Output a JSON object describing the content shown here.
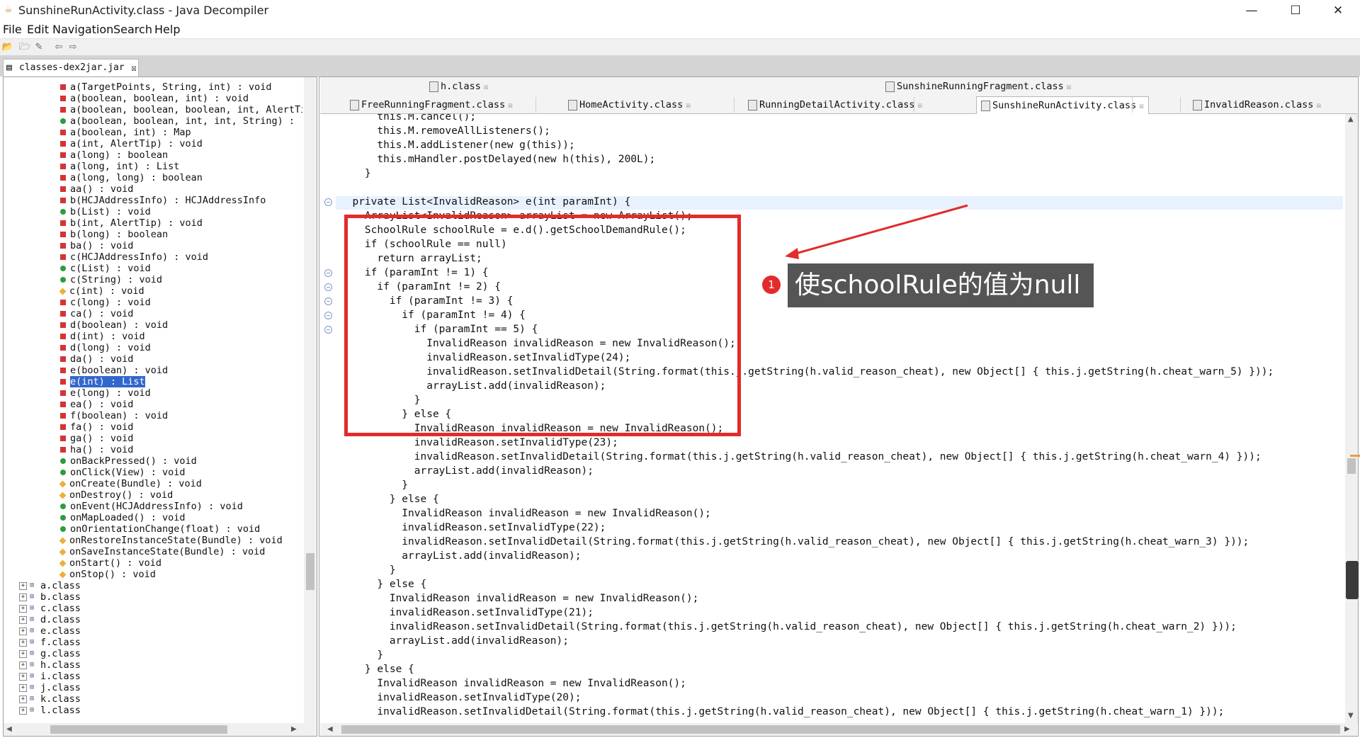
{
  "window": {
    "title": "SunshineRunActivity.class - Java Decompiler",
    "min_label": "—",
    "max_label": "☐",
    "close_label": "✕"
  },
  "menu": [
    "File",
    "Edit",
    "Navigation",
    "Search",
    "Help"
  ],
  "left_tab": {
    "label": "classes-dex2jar.jar"
  },
  "tree": {
    "members": [
      {
        "kind": "private",
        "label": "a(TargetPoints, String, int) : void"
      },
      {
        "kind": "private",
        "label": "a(boolean, boolean, int) : void"
      },
      {
        "kind": "private",
        "label": "a(boolean, boolean, boolean, int, AlertTip) : voi"
      },
      {
        "kind": "public",
        "label": "a(boolean, boolean, int, int, String) : '"
      },
      {
        "kind": "private",
        "label": "a(boolean, int) : Map"
      },
      {
        "kind": "private",
        "label": "a(int, AlertTip) : void"
      },
      {
        "kind": "private",
        "label": "a(long) : boolean"
      },
      {
        "kind": "private",
        "label": "a(long, int) : List"
      },
      {
        "kind": "private",
        "label": "a(long, long) : boolean"
      },
      {
        "kind": "private",
        "label": "aa() : void"
      },
      {
        "kind": "private",
        "label": "b(HCJAddressInfo) : HCJAddressInfo"
      },
      {
        "kind": "public",
        "label": "b(List) : void"
      },
      {
        "kind": "private",
        "label": "b(int, AlertTip) : void"
      },
      {
        "kind": "private",
        "label": "b(long) : boolean"
      },
      {
        "kind": "private",
        "label": "ba() : void"
      },
      {
        "kind": "private",
        "label": "c(HCJAddressInfo) : void"
      },
      {
        "kind": "public",
        "label": "c(List) : void"
      },
      {
        "kind": "public",
        "label": "c(String) : void"
      },
      {
        "kind": "protected",
        "label": "c(int) : void"
      },
      {
        "kind": "private",
        "label": "c(long) : void"
      },
      {
        "kind": "private",
        "label": "ca() : void"
      },
      {
        "kind": "private",
        "label": "d(boolean) : void"
      },
      {
        "kind": "private",
        "label": "d(int) : void"
      },
      {
        "kind": "private",
        "label": "d(long) : void"
      },
      {
        "kind": "private",
        "label": "da() : void"
      },
      {
        "kind": "private",
        "label": "e(boolean) : void"
      },
      {
        "kind": "private",
        "label": "e(int) : List",
        "selected": true
      },
      {
        "kind": "private",
        "label": "e(long) : void"
      },
      {
        "kind": "private",
        "label": "ea() : void"
      },
      {
        "kind": "private",
        "label": "f(boolean) : void"
      },
      {
        "kind": "private",
        "label": "fa() : void"
      },
      {
        "kind": "private",
        "label": "ga() : void"
      },
      {
        "kind": "private",
        "label": "ha() : void"
      },
      {
        "kind": "public",
        "label": "onBackPressed() : void"
      },
      {
        "kind": "public",
        "label": "onClick(View) : void"
      },
      {
        "kind": "protected",
        "label": "onCreate(Bundle) : void"
      },
      {
        "kind": "protected",
        "label": "onDestroy() : void"
      },
      {
        "kind": "public",
        "label": "onEvent(HCJAddressInfo) : void"
      },
      {
        "kind": "public",
        "label": "onMapLoaded() : void"
      },
      {
        "kind": "public",
        "label": "onOrientationChange(float) : void"
      },
      {
        "kind": "protected",
        "label": "onRestoreInstanceState(Bundle) : void"
      },
      {
        "kind": "protected",
        "label": "onSaveInstanceState(Bundle) : void"
      },
      {
        "kind": "protected",
        "label": "onStart() : void"
      },
      {
        "kind": "protected",
        "label": "onStop() : void"
      }
    ],
    "classes": [
      "a.class",
      "b.class",
      "c.class",
      "d.class",
      "e.class",
      "f.class",
      "g.class",
      "h.class",
      "i.class",
      "j.class",
      "k.class",
      "l.class"
    ]
  },
  "editor_tabs": {
    "row1": [
      "h.class",
      "SunshineRunningFragment.class"
    ],
    "row2": [
      "FreeRunningFragment.class",
      "HomeActivity.class",
      "RunningDetailActivity.class",
      "SunshineRunActivity.class",
      "InvalidReason.class"
    ],
    "active": "SunshineRunActivity.class"
  },
  "code_lines": [
    "      this.M.cancel();",
    "      this.M.removeAllListeners();",
    "      this.M.addListener(new g(this));",
    "      this.mHandler.postDelayed(new h(this), 200L);",
    "    }",
    "",
    "  private List<InvalidReason> e(int paramInt) {",
    "    ArrayList<InvalidReason> arrayList = new ArrayList();",
    "    SchoolRule schoolRule = e.d().getSchoolDemandRule();",
    "    if (schoolRule == null)",
    "      return arrayList;",
    "    if (paramInt != 1) {",
    "      if (paramInt != 2) {",
    "        if (paramInt != 3) {",
    "          if (paramInt != 4) {",
    "            if (paramInt == 5) {",
    "              InvalidReason invalidReason = new InvalidReason();",
    "              invalidReason.setInvalidType(24);",
    "              invalidReason.setInvalidDetail(String.format(this.j.getString(h.valid_reason_cheat), new Object[] { this.j.getString(h.cheat_warn_5) }));",
    "              arrayList.add(invalidReason);",
    "            }",
    "          } else {",
    "            InvalidReason invalidReason = new InvalidReason();",
    "            invalidReason.setInvalidType(23);",
    "            invalidReason.setInvalidDetail(String.format(this.j.getString(h.valid_reason_cheat), new Object[] { this.j.getString(h.cheat_warn_4) }));",
    "            arrayList.add(invalidReason);",
    "          }",
    "        } else {",
    "          InvalidReason invalidReason = new InvalidReason();",
    "          invalidReason.setInvalidType(22);",
    "          invalidReason.setInvalidDetail(String.format(this.j.getString(h.valid_reason_cheat), new Object[] { this.j.getString(h.cheat_warn_3) }));",
    "          arrayList.add(invalidReason);",
    "        }",
    "      } else {",
    "        InvalidReason invalidReason = new InvalidReason();",
    "        invalidReason.setInvalidType(21);",
    "        invalidReason.setInvalidDetail(String.format(this.j.getString(h.valid_reason_cheat), new Object[] { this.j.getString(h.cheat_warn_2) }));",
    "        arrayList.add(invalidReason);",
    "      }",
    "    } else {",
    "      InvalidReason invalidReason = new InvalidReason();",
    "      invalidReason.setInvalidType(20);",
    "      invalidReason.setInvalidDetail(String.format(this.j.getString(h.valid_reason_cheat), new Object[] { this.j.getString(h.cheat_warn_1) }));"
  ],
  "annotation": {
    "number": "1",
    "text": "使schoolRule的值为null",
    "color": "#e22b2b"
  }
}
